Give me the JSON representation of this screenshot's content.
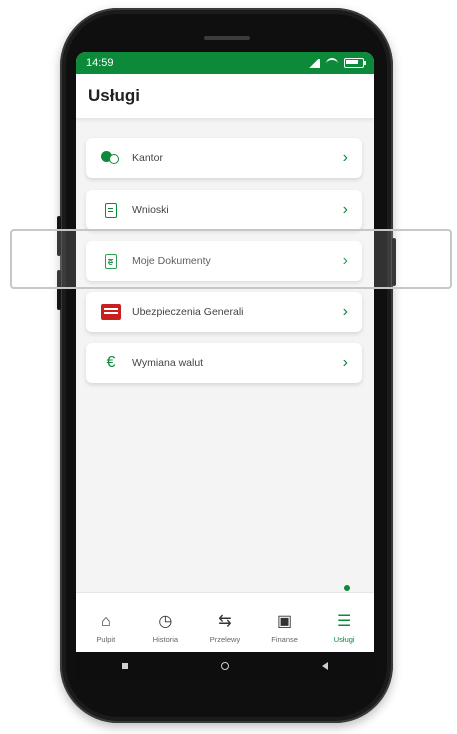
{
  "status": {
    "time": "14:59"
  },
  "header": {
    "title": "Usługi"
  },
  "menu": [
    {
      "label": "Kantor",
      "icon": "currency-exchange-icon"
    },
    {
      "label": "Wnioski",
      "icon": "document-icon"
    },
    {
      "label": "Moje Dokumenty",
      "icon": "document-e-icon"
    },
    {
      "label": "Ubezpieczenia Generali",
      "icon": "generali-logo-icon"
    },
    {
      "label": "Wymiana walut",
      "icon": "euro-icon"
    }
  ],
  "bottom_nav": [
    {
      "label": "Pulpit",
      "icon": "home-icon"
    },
    {
      "label": "Historia",
      "icon": "history-icon"
    },
    {
      "label": "Przelewy",
      "icon": "transfer-icon"
    },
    {
      "label": "Finanse",
      "icon": "wallet-icon"
    },
    {
      "label": "Usługi",
      "icon": "database-icon",
      "active": true
    }
  ],
  "colors": {
    "accent": "#0c8a3a",
    "generali_red": "#c9201f"
  }
}
